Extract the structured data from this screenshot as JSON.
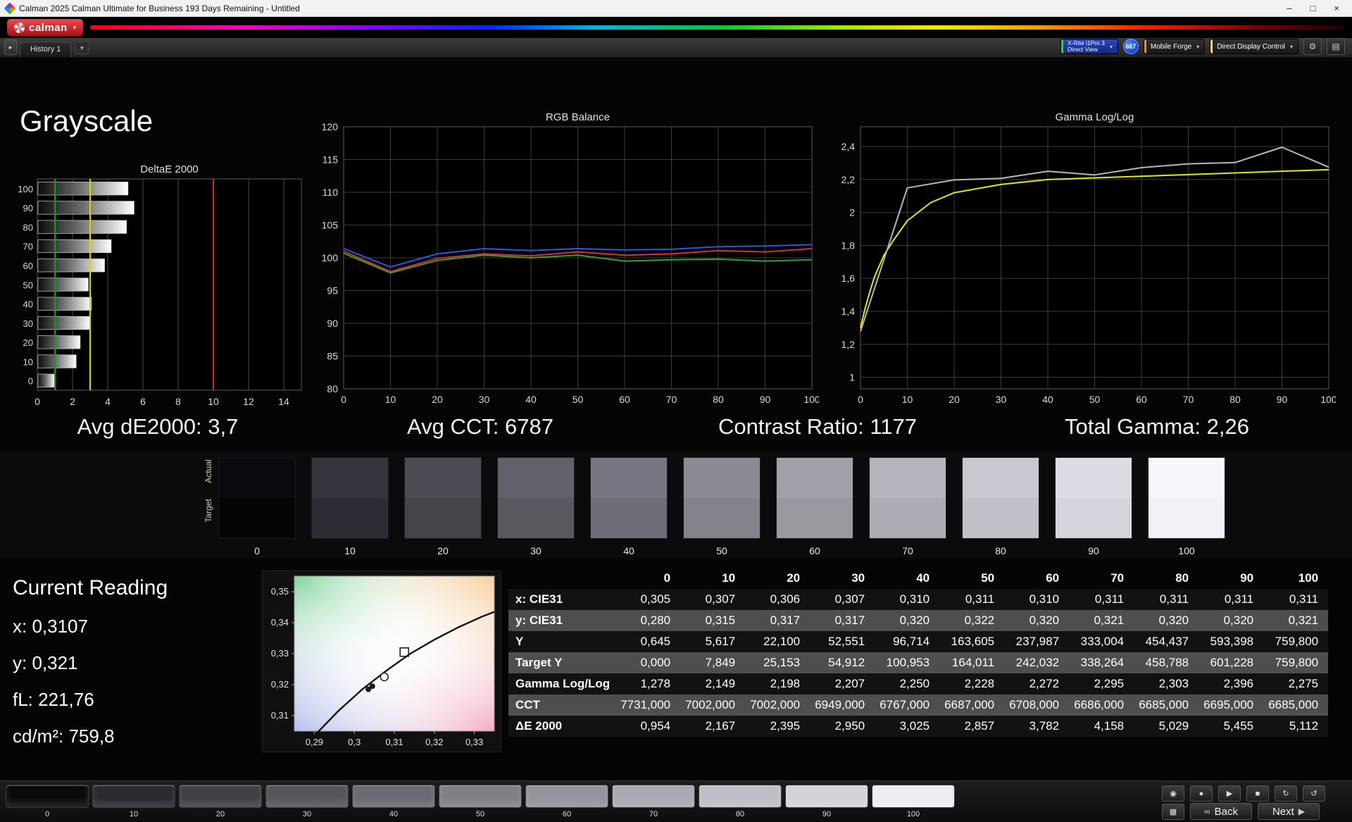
{
  "window": {
    "title": "Calman 2025 Calman Ultimate for Business 193 Days Remaining  - Untitled",
    "minimize": "–",
    "maximize": "□",
    "close": "×"
  },
  "brand": {
    "logo": "calman"
  },
  "toolbar": {
    "expander": "▸",
    "history_tab": "History 1",
    "dropdown": "▾",
    "caret": "▾",
    "meter": [
      "X-Rite i1Pro 3",
      "Direct View"
    ],
    "badge": "667",
    "source": "Mobile Forge",
    "display": "Direct Display Control",
    "gear": "⚙",
    "panel": "▤",
    "accent_meter": "#30d830",
    "accent_source": "#ff8c1e",
    "accent_display": "#ffdc28"
  },
  "page_title": "Grayscale",
  "stats": [
    "Avg dE2000: 3,7",
    "Avg CCT: 6787",
    "Contrast Ratio: 1177",
    "Total Gamma: 2,26"
  ],
  "reading": {
    "title": "Current Reading",
    "lines": [
      "x: 0,3107",
      "y: 0,321",
      "fL: 221,76",
      "cd/m²: 759,8"
    ]
  },
  "swatch_strip": {
    "row_labels": [
      "Actual",
      "Target"
    ],
    "items": [
      {
        "label": "0",
        "actual": "#0b0a10",
        "target": "#050508"
      },
      {
        "label": "10",
        "actual": "#37363e",
        "target": "#2e2d35"
      },
      {
        "label": "20",
        "actual": "#4d4c54",
        "target": "#454449"
      },
      {
        "label": "30",
        "actual": "#626169",
        "target": "#5a595f"
      },
      {
        "label": "40",
        "actual": "#777683",
        "target": "#6f6e78"
      },
      {
        "label": "50",
        "actual": "#8c8b95",
        "target": "#84838c"
      },
      {
        "label": "60",
        "actual": "#a1a0a9",
        "target": "#999aa0"
      },
      {
        "label": "70",
        "actual": "#b5b4bd",
        "target": "#aeadb5"
      },
      {
        "label": "80",
        "actual": "#c9c8d1",
        "target": "#c2c1c9"
      },
      {
        "label": "90",
        "actual": "#dddce5",
        "target": "#d6d5dd"
      },
      {
        "label": "100",
        "actual": "#f7f6fc",
        "target": "#f2f1f7"
      }
    ]
  },
  "table": {
    "columns": [
      "0",
      "10",
      "20",
      "30",
      "40",
      "50",
      "60",
      "70",
      "80",
      "90",
      "100"
    ],
    "rows": [
      {
        "label": "x: CIE31",
        "values": [
          "0,305",
          "0,307",
          "0,306",
          "0,307",
          "0,310",
          "0,311",
          "0,310",
          "0,311",
          "0,311",
          "0,311",
          "0,311"
        ]
      },
      {
        "label": "y: CIE31",
        "values": [
          "0,280",
          "0,315",
          "0,317",
          "0,317",
          "0,320",
          "0,322",
          "0,320",
          "0,321",
          "0,320",
          "0,320",
          "0,321"
        ]
      },
      {
        "label": "Y",
        "values": [
          "0,645",
          "5,617",
          "22,100",
          "52,551",
          "96,714",
          "163,605",
          "237,987",
          "333,004",
          "454,437",
          "593,398",
          "759,800"
        ]
      },
      {
        "label": "Target Y",
        "values": [
          "0,000",
          "7,849",
          "25,153",
          "54,912",
          "100,953",
          "164,011",
          "242,032",
          "338,264",
          "458,788",
          "601,228",
          "759,800"
        ]
      },
      {
        "label": "Gamma Log/Log",
        "values": [
          "1,278",
          "2,149",
          "2,198",
          "2,207",
          "2,250",
          "2,228",
          "2,272",
          "2,295",
          "2,303",
          "2,396",
          "2,275"
        ]
      },
      {
        "label": "CCT",
        "values": [
          "7731,000",
          "7002,000",
          "7002,000",
          "6949,000",
          "6767,000",
          "6687,000",
          "6708,000",
          "6686,000",
          "6685,000",
          "6695,000",
          "6685,000"
        ]
      },
      {
        "label": "ΔE 2000",
        "values": [
          "0,954",
          "2,167",
          "2,395",
          "2,950",
          "3,025",
          "2,857",
          "3,782",
          "4,158",
          "5,029",
          "5,455",
          "5,112"
        ]
      }
    ]
  },
  "chart_data": {
    "deltae": {
      "type": "bar",
      "title": "DeltaE 2000",
      "categories": [
        "100",
        "90",
        "80",
        "70",
        "60",
        "50",
        "40",
        "30",
        "20",
        "10",
        "0"
      ],
      "values": [
        5.112,
        5.455,
        5.029,
        4.158,
        3.782,
        2.857,
        3.025,
        2.95,
        2.395,
        2.167,
        0.954
      ],
      "xticks": [
        0,
        2,
        4,
        6,
        8,
        10,
        12,
        14
      ],
      "xlim": [
        0,
        15
      ],
      "ref_lines": [
        {
          "x": 1,
          "color": "#00aa00"
        },
        {
          "x": 3,
          "color": "#d8d800"
        },
        {
          "x": 10,
          "color": "#dd2222"
        }
      ]
    },
    "rgb_balance": {
      "type": "line",
      "title": "RGB Balance",
      "x": [
        0,
        10,
        20,
        30,
        40,
        50,
        60,
        70,
        80,
        90,
        100
      ],
      "xlim": [
        0,
        100
      ],
      "ylim": [
        80,
        120
      ],
      "xticks": [
        0,
        10,
        20,
        30,
        40,
        50,
        60,
        70,
        80,
        90,
        100
      ],
      "yticks": [
        [
          80,
          "80"
        ],
        [
          85,
          "85"
        ],
        [
          90,
          "90"
        ],
        [
          95,
          "95"
        ],
        [
          100,
          "100"
        ],
        [
          105,
          "105"
        ],
        [
          110,
          "110"
        ],
        [
          115,
          "115"
        ],
        [
          120,
          "120"
        ]
      ],
      "series": [
        {
          "name": "green",
          "color": "#28a828",
          "values": [
            100.7,
            97.7,
            99.6,
            100.4,
            100.0,
            100.4,
            99.5,
            99.7,
            99.8,
            99.5,
            99.7
          ]
        },
        {
          "name": "red",
          "color": "#d83030",
          "values": [
            101.0,
            97.9,
            99.9,
            100.6,
            100.3,
            100.9,
            100.4,
            100.6,
            101.1,
            100.9,
            101.4
          ]
        },
        {
          "name": "blue",
          "color": "#2858e8",
          "values": [
            101.4,
            98.6,
            100.6,
            101.4,
            101.1,
            101.4,
            101.2,
            101.3,
            101.7,
            101.8,
            102.0
          ]
        }
      ]
    },
    "gamma": {
      "type": "line",
      "title": "Gamma Log/Log",
      "xlim": [
        0,
        100
      ],
      "ylim": [
        0.93,
        2.52
      ],
      "xticks": [
        0,
        10,
        20,
        30,
        40,
        50,
        60,
        70,
        80,
        90,
        100
      ],
      "yticks": [
        [
          1,
          "1"
        ],
        [
          1.2,
          "1,2"
        ],
        [
          1.4,
          "1,4"
        ],
        [
          1.6,
          "1,6"
        ],
        [
          1.8,
          "1,8"
        ],
        [
          2,
          "2"
        ],
        [
          2.2,
          "2,2"
        ],
        [
          2.4,
          "2,4"
        ]
      ],
      "series": [
        {
          "name": "target",
          "color": "#e8e800",
          "x": [
            0,
            1,
            2,
            3,
            5,
            7,
            10,
            15,
            20,
            30,
            40,
            50,
            60,
            70,
            80,
            90,
            100
          ],
          "values": [
            1.3,
            1.42,
            1.52,
            1.61,
            1.74,
            1.83,
            1.95,
            2.06,
            2.12,
            2.17,
            2.2,
            2.21,
            2.22,
            2.23,
            2.24,
            2.25,
            2.26
          ]
        },
        {
          "name": "measured",
          "color": "#b8b8b8",
          "x": [
            0,
            10,
            20,
            30,
            40,
            50,
            60,
            70,
            80,
            90,
            100
          ],
          "values": [
            1.278,
            2.149,
            2.198,
            2.207,
            2.25,
            2.228,
            2.272,
            2.295,
            2.303,
            2.396,
            2.275
          ]
        }
      ]
    },
    "cie": {
      "type": "scatter",
      "xlim": [
        0.285,
        0.335
      ],
      "ylim": [
        0.305,
        0.355
      ],
      "xticks": [
        [
          0.29,
          "0,29"
        ],
        [
          0.3,
          "0,3"
        ],
        [
          0.31,
          "0,31"
        ],
        [
          0.32,
          "0,32"
        ],
        [
          0.33,
          "0,33"
        ]
      ],
      "yticks": [
        [
          0.31,
          "0,31"
        ],
        [
          0.32,
          "0,32"
        ],
        [
          0.33,
          "0,33"
        ],
        [
          0.34,
          "0,34"
        ],
        [
          0.35,
          "0,35"
        ]
      ],
      "locus": [
        [
          0.29,
          0.3035
        ],
        [
          0.296,
          0.3115
        ],
        [
          0.302,
          0.3185
        ],
        [
          0.308,
          0.3245
        ],
        [
          0.314,
          0.33
        ],
        [
          0.32,
          0.3345
        ],
        [
          0.326,
          0.3385
        ],
        [
          0.332,
          0.342
        ],
        [
          0.335,
          0.3435
        ]
      ],
      "dots": [
        [
          0.3035,
          0.3185
        ],
        [
          0.3045,
          0.3195
        ]
      ],
      "circle_marker": [
        0.3075,
        0.3225
      ],
      "square_marker": [
        0.3125,
        0.3305
      ]
    }
  },
  "bottom_bar": {
    "levels": [
      {
        "label": "0",
        "color": "#0a0a0a"
      },
      {
        "label": "10",
        "color": "#2b2a31"
      },
      {
        "label": "20",
        "color": "#414047"
      },
      {
        "label": "30",
        "color": "#56555c"
      },
      {
        "label": "40",
        "color": "#6b6a72"
      },
      {
        "label": "50",
        "color": "#808087"
      },
      {
        "label": "60",
        "color": "#95949c"
      },
      {
        "label": "70",
        "color": "#aaa9b1"
      },
      {
        "label": "80",
        "color": "#bfbec6"
      },
      {
        "label": "90",
        "color": "#d4d3da"
      },
      {
        "label": "100",
        "color": "#edecf2"
      }
    ],
    "transport": [
      "◉",
      "●",
      "▶",
      "■",
      "↻",
      "↺"
    ],
    "transport_names": [
      "meter-button",
      "record-button",
      "play-button",
      "stop-button",
      "repeat-button",
      "refresh-button"
    ],
    "layout_button": "▦",
    "back": "Back",
    "back_icon": "∞",
    "next": "Next",
    "next_icon": "▶"
  }
}
